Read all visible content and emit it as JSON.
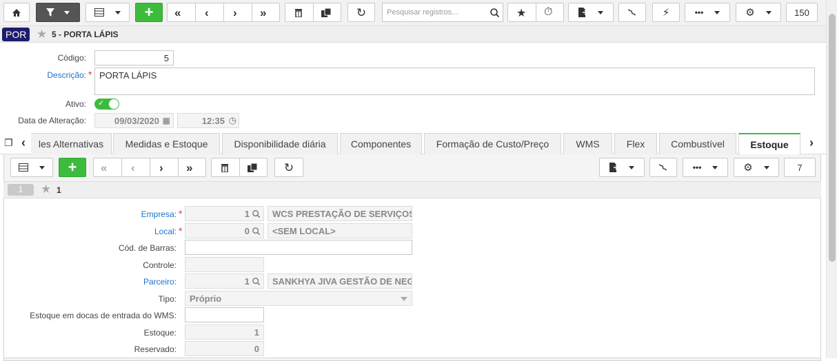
{
  "toolbar": {
    "search_placeholder": "Pesquisar registros...",
    "record_count": "150"
  },
  "title": {
    "badge": "POR",
    "record": "5 - PORTA LÁPIS"
  },
  "form": {
    "codigo_label": "Código:",
    "codigo_value": "5",
    "descricao_label": "Descrição:",
    "descricao_value": "PORTA LÁPIS",
    "ativo_label": "Ativo:",
    "ativo_on": true,
    "data_label": "Data de Alteração:",
    "data_value": "09/03/2020",
    "hora_value": "12:35"
  },
  "tabs": [
    {
      "label": "les Alternativas"
    },
    {
      "label": "Medidas e Estoque"
    },
    {
      "label": "Disponibilidade diária"
    },
    {
      "label": "Componentes"
    },
    {
      "label": "Formação de Custo/Preço"
    },
    {
      "label": "WMS"
    },
    {
      "label": "Flex"
    },
    {
      "label": "Combustível"
    },
    {
      "label": "Estoque"
    }
  ],
  "subtoolbar": {
    "record_count": "7"
  },
  "subtitle": {
    "badge": "1",
    "record": "1"
  },
  "estoque": {
    "empresa_label": "Empresa:",
    "empresa_code": "1",
    "empresa_name": "WCS PRESTAÇÃO DE SERVIÇOS",
    "local_label": "Local:",
    "local_code": "0",
    "local_name": "<SEM LOCAL>",
    "barras_label": "Cód. de Barras:",
    "barras_value": "",
    "controle_label": "Controle:",
    "controle_value": "",
    "parceiro_label": "Parceiro:",
    "parceiro_code": "1",
    "parceiro_name": "SANKHYA JIVA GESTÃO DE NEGÓCIOS",
    "tipo_label": "Tipo:",
    "tipo_value": "Próprio",
    "docas_label": "Estoque em docas de entrada do WMS:",
    "docas_value": "",
    "estoque_label": "Estoque:",
    "estoque_value": "1",
    "reservado_label": "Reservado:",
    "reservado_value": "0"
  },
  "colors": {
    "accent_green": "#3dbb3d",
    "link_blue": "#1a73c9",
    "badge_navy": "#1d1d6e",
    "required_red": "#e53935"
  }
}
